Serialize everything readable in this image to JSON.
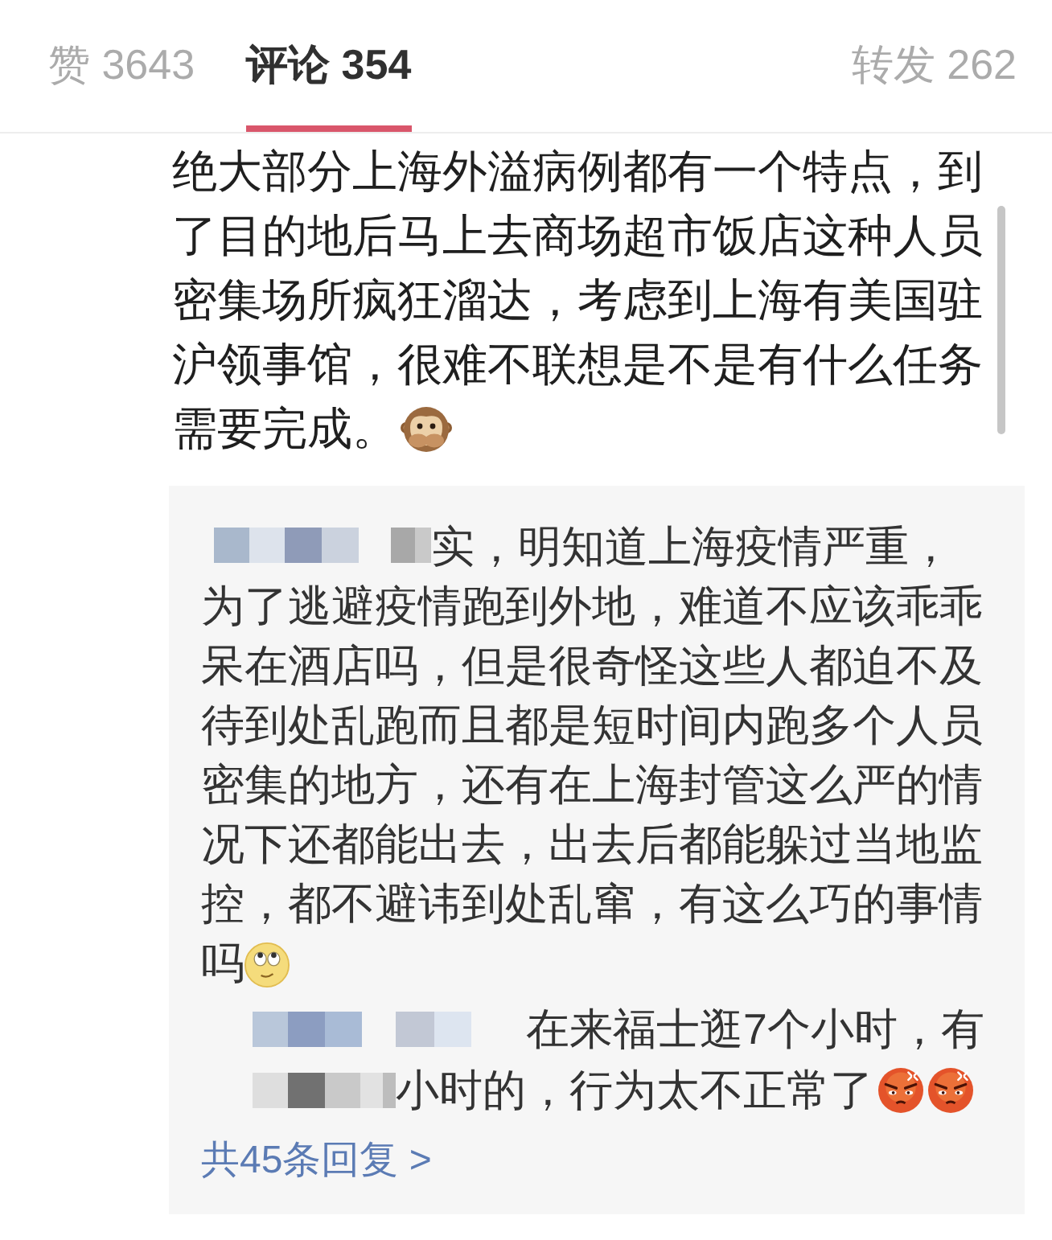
{
  "tabs": [
    {
      "label": "赞 3643",
      "selected": false
    },
    {
      "label": "评论 354",
      "selected": true
    },
    {
      "label": "转发 262",
      "selected": false
    }
  ],
  "comment": {
    "text": "绝大部分上海外溢病例都有一个特点，到了目的地后马上去商场超市饭店这种人员密集场所疯狂溜达，考虑到上海有美国驻沪领事馆，很难不联想是不是有什么任务",
    "last_line": "需要完成。"
  },
  "reply": {
    "first_line": "实，明知道上海疫情严重，",
    "text": "为了逃避疫情跑到外地，难道不应该乖乖呆在酒店吗，但是很奇怪这些人都迫不及待到处乱跑而且都是短时间内跑多个人员密集的地方，还有在上海封管这么严的情况下还都能出去，出去后都能躲过当地监控，都不避讳到处乱窜，有这么巧的事情",
    "last_line": "吗"
  },
  "sub_reply": {
    "lines": [
      "在来福士逛7个小时，有",
      "小时的，行为太不正常了"
    ]
  },
  "more_replies": "共45条回复 >"
}
